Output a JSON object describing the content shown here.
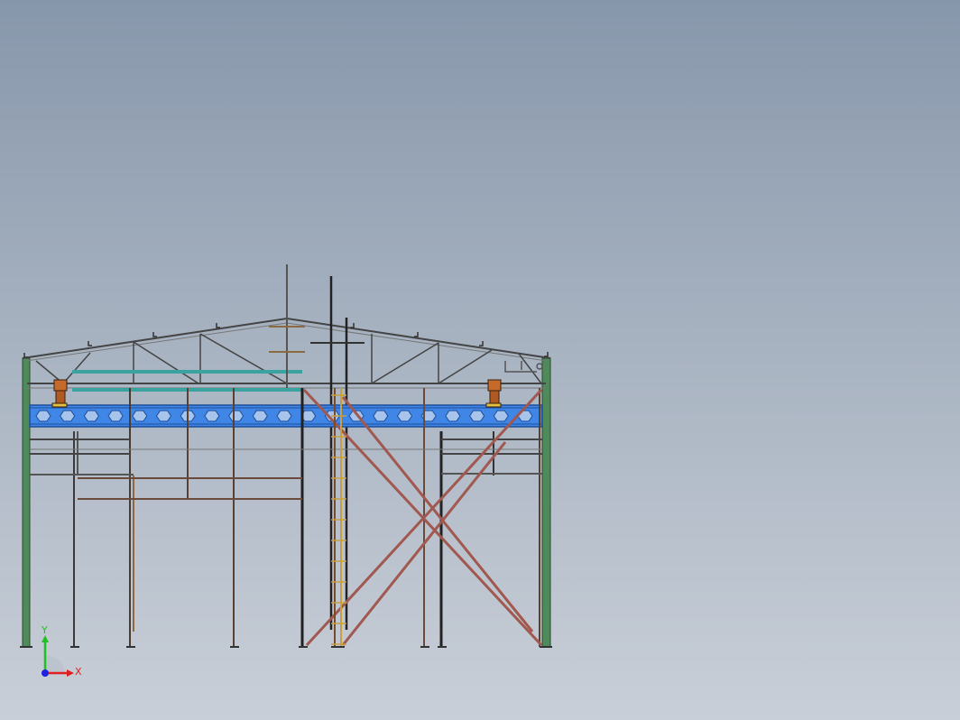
{
  "window": {
    "title": ""
  },
  "viewport": {
    "background_top": "#8797ab",
    "background_bottom": "#c9cfd8"
  },
  "model": {
    "description_colors": {
      "column_green": "#4f8a5a",
      "steel_dark": "#3a3a3a",
      "steel_rust": "#8a5a3a",
      "brace_red": "#a0584f",
      "beam_blue": "#3f86e6",
      "beam_blue_dark": "#2a5fb0",
      "teal_pipe": "#3aa3a0",
      "hoist_orange": "#c46a2a",
      "ladder_yellow": "#c8a040"
    }
  },
  "triad": {
    "x_label": "X",
    "y_label": "Y",
    "x_color": "#e02020",
    "y_color": "#20c020",
    "z_color": "#2020e0"
  }
}
